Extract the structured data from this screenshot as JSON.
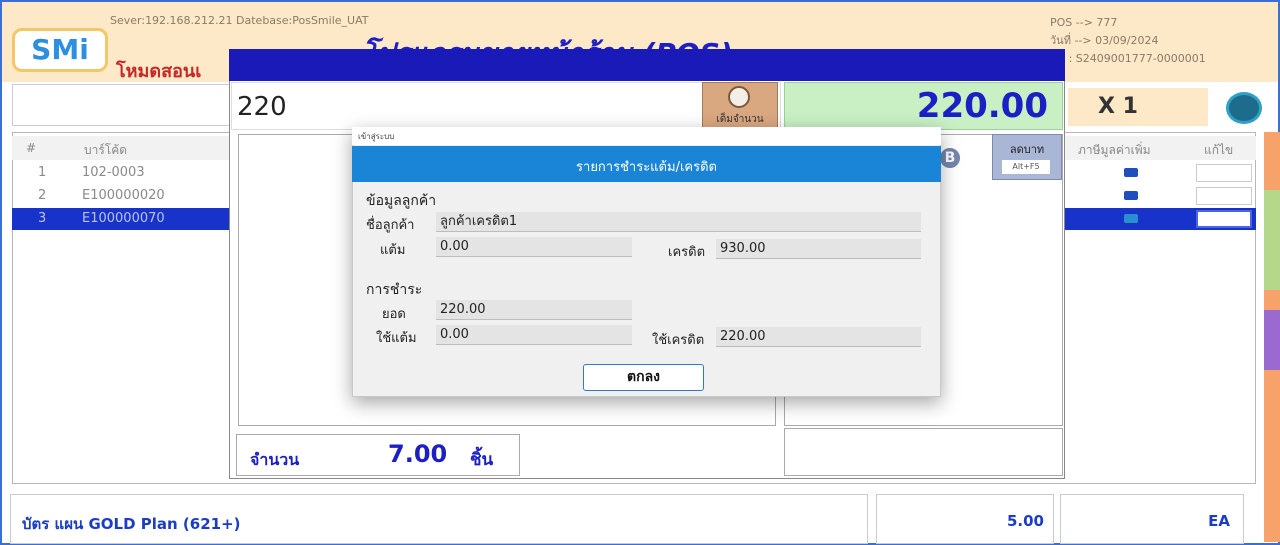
{
  "app": {
    "server_line": "Sever:192.168.212.21 Datebase:PosSmile_UAT",
    "logo_text": "SMi",
    "mode_label": "โหมดสอนเ",
    "title": "โปรแกรมขายหน้าร้าน (POS)",
    "pos_info": [
      "POS --> 777",
      "วันที่ --> 03/09/2024",
      "BB : S2409001777-0000001"
    ],
    "qty_multiplier": "X 1"
  },
  "grid": {
    "columns": [
      "#",
      "บาร์โค้ด",
      "ภาษีมูลค่าเพิ่ม",
      "แก้ไข"
    ],
    "rows": [
      {
        "no": "1",
        "barcode": "102-0003"
      },
      {
        "no": "2",
        "barcode": "E100000020"
      },
      {
        "no": "3",
        "barcode": "E100000070"
      }
    ]
  },
  "bottom": {
    "plan_text": "บัตร แผน GOLD Plan (621+)",
    "value": "5.00",
    "unit": "EA"
  },
  "payment": {
    "amount_input": "220",
    "fill_button_label": "เต็มจำนวน",
    "total": "220.00",
    "baht_button_label": "ลดบาท",
    "baht_button_hotkey": "Alt+F5",
    "baht_symbol": "B",
    "count_label": "จำนวน",
    "count_value": "7.00",
    "count_unit": "ชิ้น"
  },
  "dialog": {
    "window_title": "เข้าสู่ระบบ",
    "header": "รายการชำระแต้ม/เครดิต",
    "customer_section": "ข้อมูลลูกค้า",
    "customer_name_label": "ชื่อลูกค้า",
    "customer_name": "ลูกค้าเครดิต1",
    "points_label": "แต้ม",
    "points": "0.00",
    "credit_label": "เครดิต",
    "credit": "930.00",
    "payment_section": "การชำระ",
    "amount_label": "ยอด",
    "amount": "220.00",
    "use_points_label": "ใช้แต้ม",
    "use_points": "0.00",
    "use_credit_label": "ใช้เครดิต",
    "use_credit": "220.00",
    "ok_label": "ตกลง"
  }
}
